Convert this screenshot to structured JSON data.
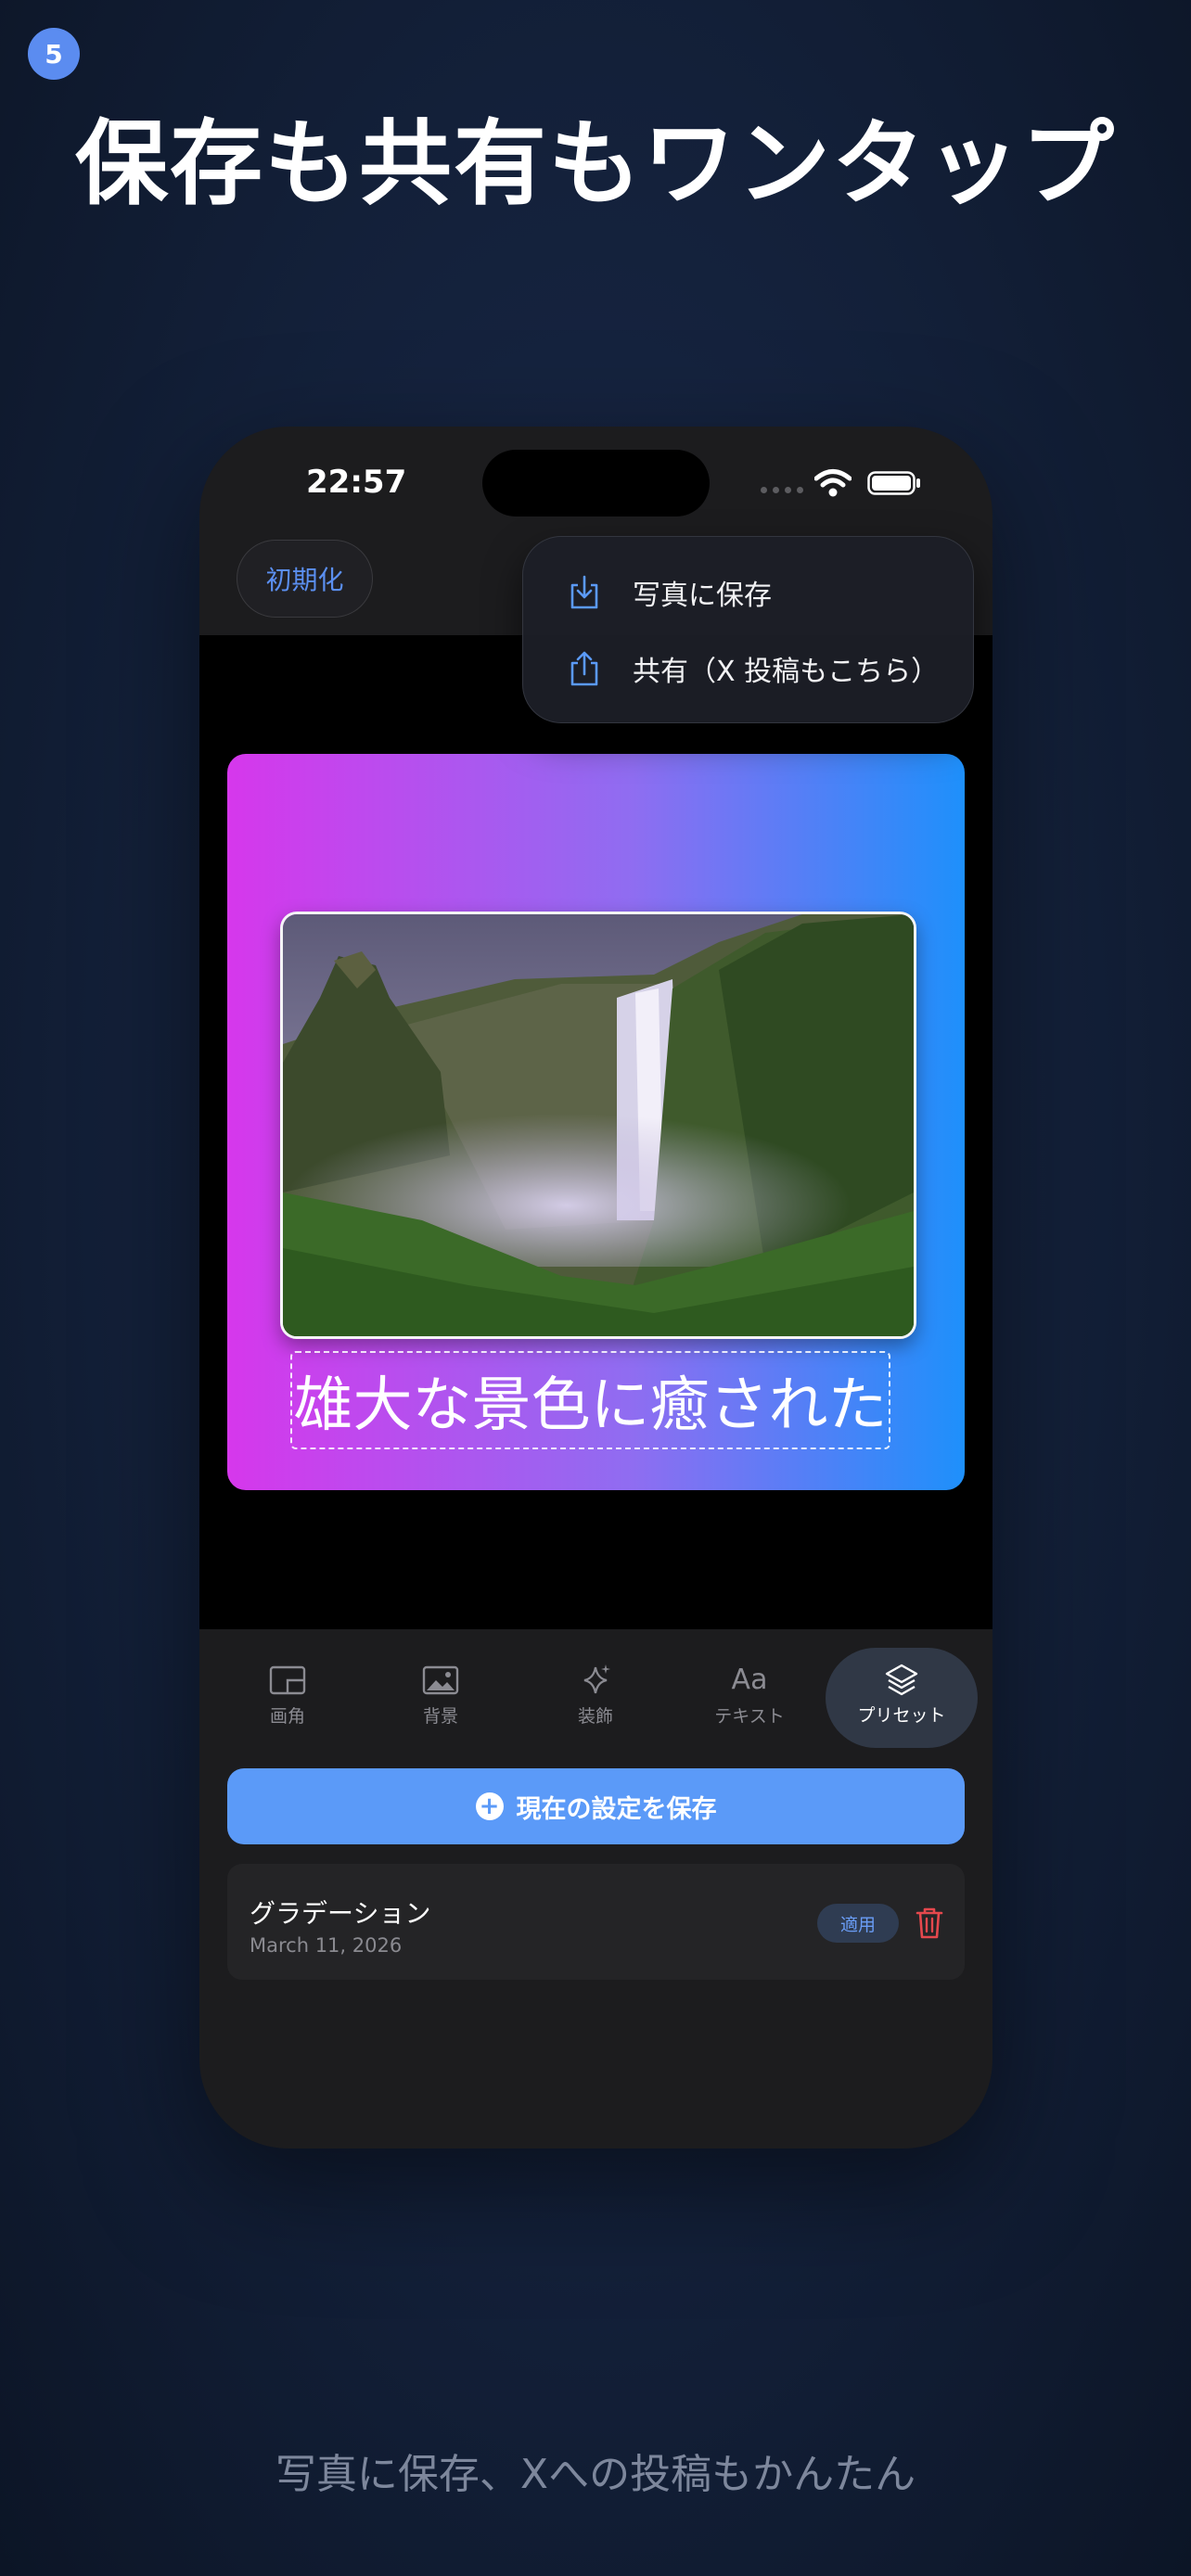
{
  "step_number": "5",
  "headline": "保存も共有もワンタップ",
  "caption": "写真に保存、Xへの投稿もかんたん",
  "status_bar": {
    "time": "22:57"
  },
  "top_bar": {
    "reset_label": "初期化"
  },
  "menu": {
    "items": [
      {
        "icon": "download-icon",
        "label": "写真に保存"
      },
      {
        "icon": "share-icon",
        "label": "共有（X 投稿もこちら）"
      }
    ]
  },
  "canvas": {
    "overlay_text": "雄大な景色に癒された",
    "gradient": [
      "#d637ec",
      "#8f6df1",
      "#1e90fb"
    ]
  },
  "tabs": [
    {
      "icon": "aspect-ratio-icon",
      "label": "画角",
      "active": false
    },
    {
      "icon": "image-icon",
      "label": "背景",
      "active": false
    },
    {
      "icon": "sparkles-icon",
      "label": "装飾",
      "active": false
    },
    {
      "icon": "text-aa-icon",
      "icon_text": "Aa",
      "label": "テキスト",
      "active": false
    },
    {
      "icon": "layers-icon",
      "label": "プリセット",
      "active": true
    }
  ],
  "save_preset_button": {
    "label": "現在の設定を保存"
  },
  "presets": [
    {
      "name": "グラデーション",
      "date": "March 11, 2026",
      "apply_label": "適用"
    }
  ],
  "colors": {
    "accent": "#5b9af8",
    "delete": "#e5484d",
    "badge": "#5b8cf0"
  }
}
